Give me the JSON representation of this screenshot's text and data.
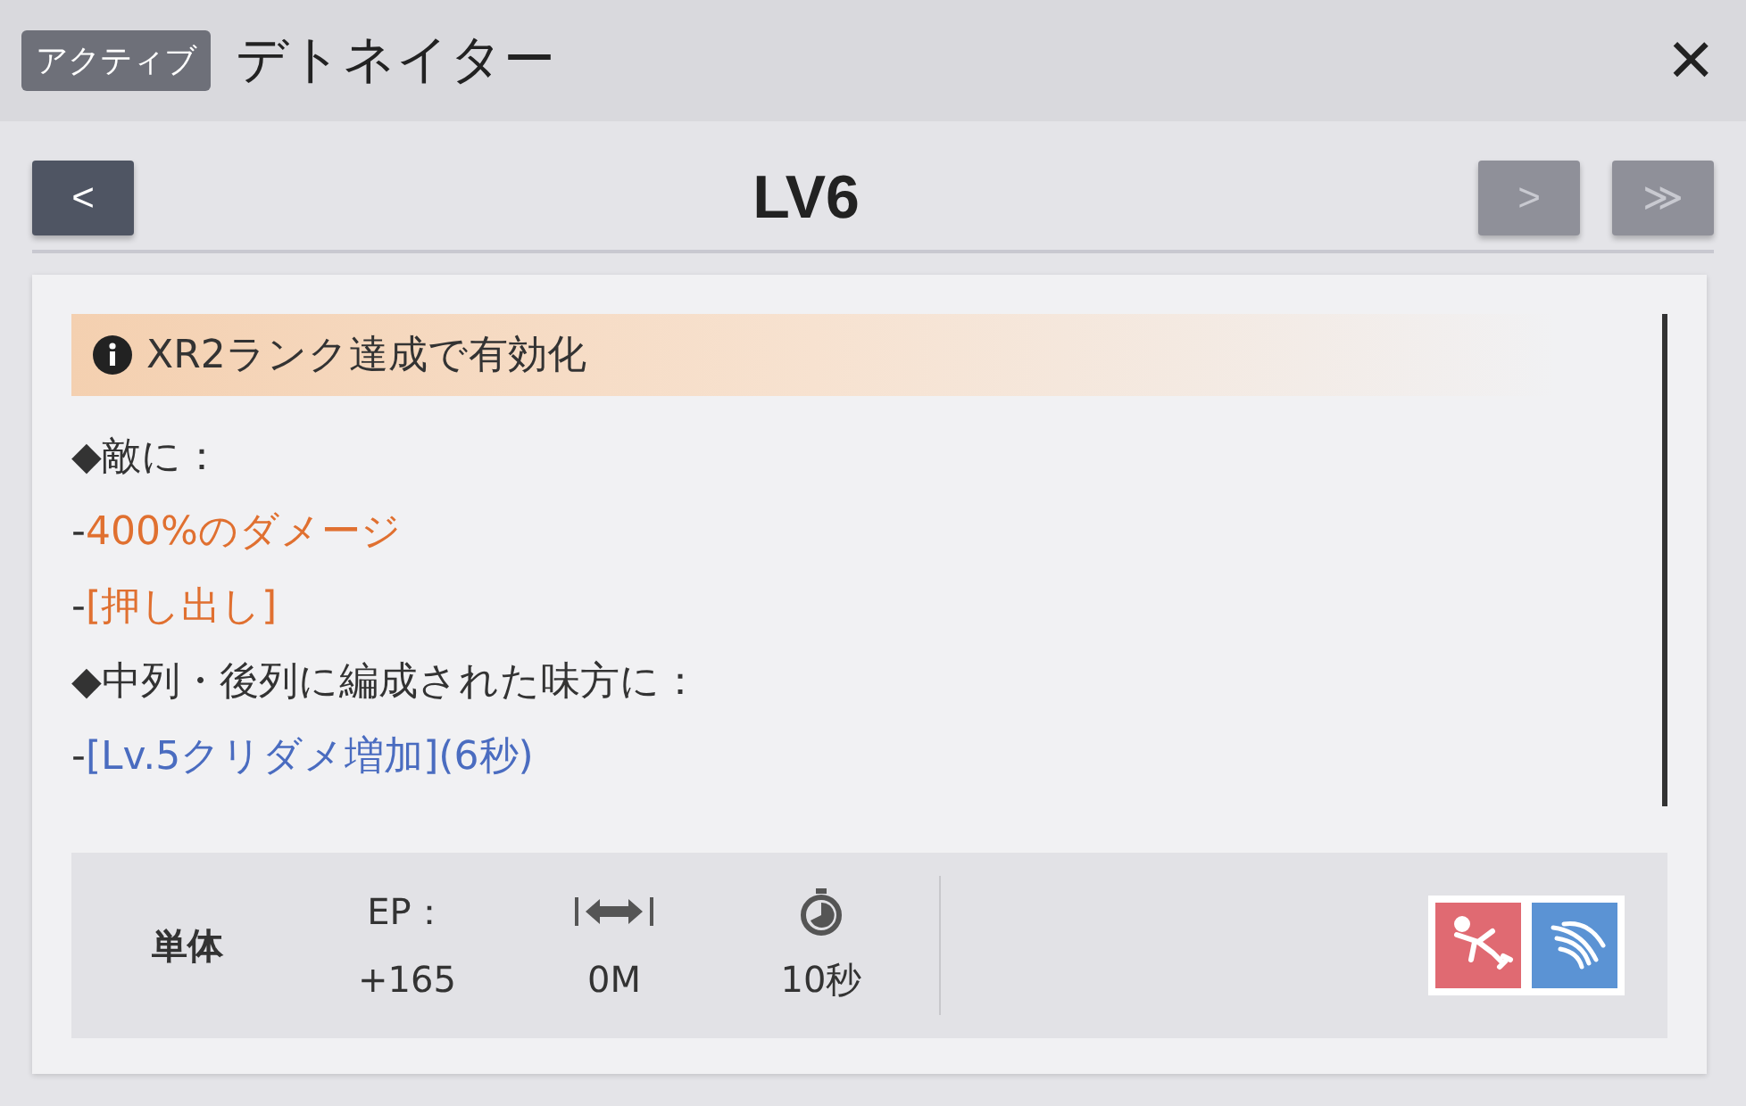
{
  "header": {
    "badge": "アクティブ",
    "title": "デトネイター",
    "close": "×"
  },
  "level_nav": {
    "title": "LV6",
    "buttons": [
      {
        "kind": "prev",
        "label": "<",
        "disabled": false
      },
      {
        "kind": "next",
        "label": ">",
        "disabled": true
      },
      {
        "kind": "last",
        "label": "≫",
        "disabled": true
      }
    ]
  },
  "notice": "XR2ランク達成で有効化",
  "lines": [
    {
      "kind": "heading",
      "prefix": "◆",
      "text": "敵に："
    },
    {
      "kind": "damage",
      "prefix": "-",
      "text": "400%のダメージ"
    },
    {
      "kind": "damage",
      "prefix": "-",
      "text": "[押し出し]"
    },
    {
      "kind": "heading",
      "prefix": "◆",
      "text": "中列・後列に編成された味方に："
    },
    {
      "kind": "buff",
      "prefix": "-",
      "text": "[Lv.5クリダメ増加](6秒)"
    }
  ],
  "stats": {
    "target": "単体",
    "ep_label": "EP：",
    "ep_value": "+165",
    "range": "0M",
    "cooldown": "10秒"
  },
  "tags": [
    {
      "kind": "knockback",
      "color": "#e06a72"
    },
    {
      "kind": "wave",
      "color": "#5b93d4"
    }
  ]
}
